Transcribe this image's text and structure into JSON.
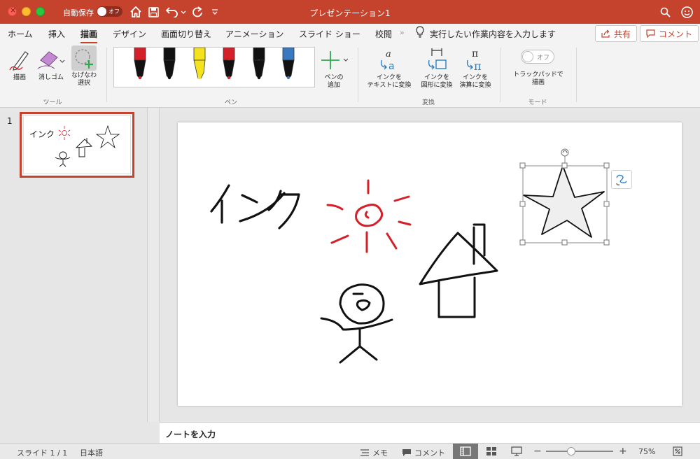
{
  "titlebar": {
    "autosave_label": "自動保存",
    "autosave_state": "オフ",
    "doc_title": "プレゼンテーション1"
  },
  "tabs": [
    {
      "label": "ホーム"
    },
    {
      "label": "挿入"
    },
    {
      "label": "描画",
      "active": true
    },
    {
      "label": "デザイン"
    },
    {
      "label": "画面切り替え"
    },
    {
      "label": "アニメーション"
    },
    {
      "label": "スライド ショー"
    },
    {
      "label": "校閲"
    }
  ],
  "tellme": "実行したい作業内容を入力します",
  "share_label": "共有",
  "comment_label": "コメント",
  "ribbon": {
    "tools": {
      "draw_label": "描画",
      "eraser_label": "消しゴム",
      "lasso_label_1": "なげなわ",
      "lasso_label_2": "選択",
      "group_label": "ツール"
    },
    "pens": {
      "group_label": "ペン",
      "add_pen_label_1": "ペンの",
      "add_pen_label_2": "追加",
      "colors": [
        "#d5202a",
        "#111111",
        "#f4e21d",
        "#d5202a",
        "#111111",
        "#3a78c0"
      ]
    },
    "convert": {
      "group_label": "変換",
      "ink_to_text_1": "インクを",
      "ink_to_text_2": "テキストに変換",
      "ink_to_shape_1": "インクを",
      "ink_to_shape_2": "図形に変換",
      "ink_to_math_1": "インクを",
      "ink_to_math_2": "演算に変換"
    },
    "mode": {
      "group_label": "モード",
      "toggle_state": "オフ",
      "trackpad_label_1": "トラックパッドで",
      "trackpad_label_2": "描画"
    }
  },
  "thumbnails": [
    {
      "number": "1"
    }
  ],
  "slide": {
    "ink_text": "インク"
  },
  "notes_placeholder": "ノートを入力",
  "statusbar": {
    "slide_info": "スライド 1 / 1",
    "language": "日本語",
    "notes_label": "メモ",
    "comments_label": "コメント",
    "zoom": "75%"
  },
  "accent": "#c5432d"
}
